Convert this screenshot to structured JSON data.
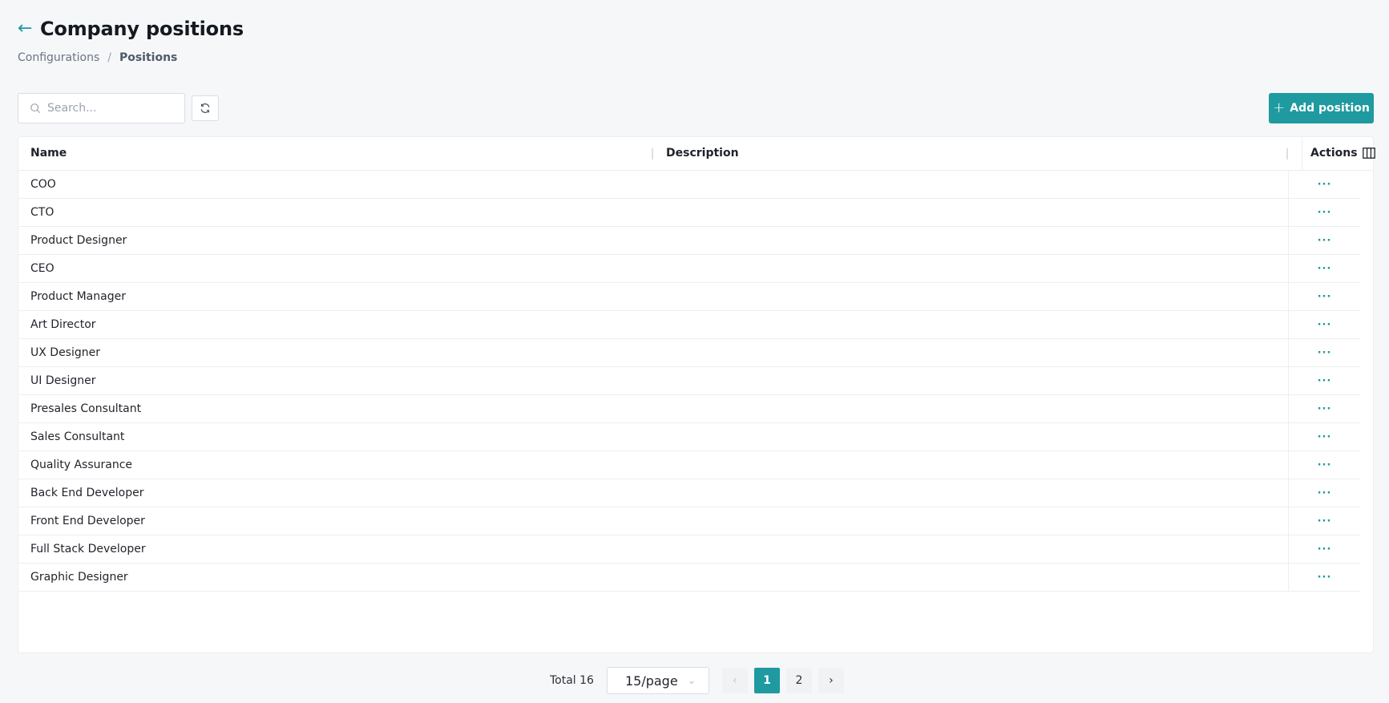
{
  "header": {
    "back_icon": "←",
    "title": "Company positions",
    "breadcrumb": [
      {
        "label": "Configurations"
      },
      {
        "label": "Positions"
      }
    ],
    "breadcrumb_separator": "/"
  },
  "toolbar": {
    "search_placeholder": "Search...",
    "search_value": "",
    "refresh_icon": "refresh-icon",
    "add_label": "Add position",
    "add_icon": "+"
  },
  "colors": {
    "accent": "#1e9aa0",
    "background": "#f6f7f9"
  },
  "table": {
    "columns": {
      "name": "Name",
      "description": "Description",
      "actions": "Actions"
    },
    "actions_glyph": "···",
    "rows": [
      {
        "name": "COO",
        "description": ""
      },
      {
        "name": "CTO",
        "description": ""
      },
      {
        "name": "Product Designer",
        "description": ""
      },
      {
        "name": "CEO",
        "description": ""
      },
      {
        "name": "Product Manager",
        "description": ""
      },
      {
        "name": "Art Director",
        "description": ""
      },
      {
        "name": "UX Designer",
        "description": ""
      },
      {
        "name": "UI Designer",
        "description": ""
      },
      {
        "name": "Presales Consultant",
        "description": ""
      },
      {
        "name": "Sales Consultant",
        "description": ""
      },
      {
        "name": "Quality Assurance",
        "description": ""
      },
      {
        "name": "Back End Developer",
        "description": ""
      },
      {
        "name": "Front End Developer",
        "description": ""
      },
      {
        "name": "Full Stack Developer",
        "description": ""
      },
      {
        "name": "Graphic Designer",
        "description": ""
      }
    ]
  },
  "pagination": {
    "total_label": "Total 16",
    "page_size": "15/page",
    "prev": "‹",
    "next": "›",
    "pages": [
      "1",
      "2"
    ],
    "current_page": "1"
  }
}
